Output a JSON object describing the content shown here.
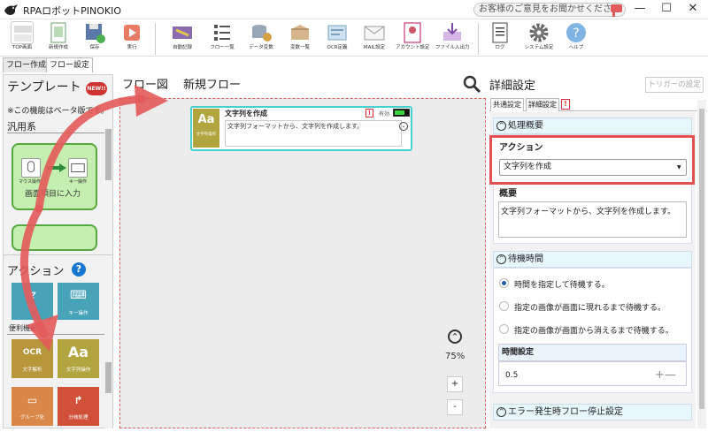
{
  "window": {
    "title": "RPAロボットPINOKIO",
    "feedback": "お客様のご意見をお聞かせください",
    "minimize": "—",
    "maximize": "☐",
    "close": "✕"
  },
  "ribbon": [
    {
      "name": "top-screen",
      "label": "TOP画面",
      "icon": "top-screen-icon"
    },
    {
      "name": "new-create",
      "label": "新規作成",
      "icon": "new-file-icon"
    },
    {
      "name": "save",
      "label": "保存",
      "icon": "save-icon"
    },
    {
      "name": "run",
      "label": "実行",
      "icon": "run-icon"
    },
    {
      "name": "auto-record",
      "label": "自動記録",
      "icon": "auto-record-icon"
    },
    {
      "name": "flow-list",
      "label": "フロー一覧",
      "icon": "list-icon"
    },
    {
      "name": "data-settings",
      "label": "データ変数",
      "icon": "data-icon"
    },
    {
      "name": "variable-list",
      "label": "変数一覧",
      "icon": "box-icon"
    },
    {
      "name": "ocr-settings",
      "label": "OCR定義",
      "icon": "ocr-icon"
    },
    {
      "name": "mail-settings",
      "label": "MAIL設定",
      "icon": "mail-icon"
    },
    {
      "name": "account-settings",
      "label": "アカウント設定",
      "icon": "account-icon"
    },
    {
      "name": "file-io",
      "label": "ファイル入出力",
      "icon": "file-io-icon"
    },
    {
      "name": "log",
      "label": "ログ",
      "icon": "log-icon"
    },
    {
      "name": "system-settings",
      "label": "システム設定",
      "icon": "gear-icon"
    },
    {
      "name": "help",
      "label": "ヘルプ",
      "icon": "help-icon"
    }
  ],
  "tabs": {
    "flow_create": "フロー作成",
    "flow_settings": "フロー設定"
  },
  "left": {
    "template_heading": "テンプレート",
    "new_badge": "NEW!!",
    "beta_note": "※この機能はベータ版です。",
    "general": "汎用系",
    "template1_label": "画面項目に入力",
    "mouse_op": "マウス操作",
    "key_op": "キー操作",
    "action_heading": "アクション",
    "help": "?",
    "mouse_partial": "マ",
    "key_tile": "キー操作",
    "convenience": "便利機能",
    "ocr_tile": "文字解析",
    "ocr_big": "OCR",
    "text_tile": "文字列操作",
    "text_big": "Aa",
    "group_tile": "グループ化",
    "branch_tile": "分岐処理"
  },
  "center": {
    "flow_label": "フロー図",
    "flow_name": "新規フロー",
    "node": {
      "icon_big": "Aa",
      "icon_label": "文字列操作",
      "title": "文字列を作成",
      "warn": "!",
      "enabled": "有効",
      "desc": "文字列フォーマットから、文字列を作成します。",
      "expand": "⌄"
    },
    "zoom_up": "^",
    "zoom": "75%",
    "zoom_in": "+",
    "zoom_out": "-"
  },
  "right": {
    "title": "詳細設定",
    "trigger_button": "トリガーの設定",
    "tab_common": "共通設定",
    "tab_detail": "詳細設定",
    "tab_warn": "!",
    "section1": "処理概要",
    "action_label": "アクション",
    "action_value": "文字列を作成",
    "summary_label": "概要",
    "summary_text": "文字列フォーマットから、文字列を作成します。",
    "section2": "待機時間",
    "radios": [
      "時間を指定して待機する。",
      "指定の画像が画面に現れるまで待機する。",
      "指定の画像が画面から消えるまで待機する。"
    ],
    "time_label": "時間設定",
    "time_value": "0.5",
    "plus_minus": "+—",
    "section3": "エラー発生時フロー停止設定"
  },
  "colors": {
    "accent": "#47d0d0",
    "arrow": "#e35a5a",
    "template_green": "#c5efb0",
    "ocr_tile": "#b8963b",
    "text_tile": "#b2a53f",
    "group_tile": "#d9884a",
    "branch_tile": "#d0503a",
    "key_tile": "#47a3b8"
  }
}
